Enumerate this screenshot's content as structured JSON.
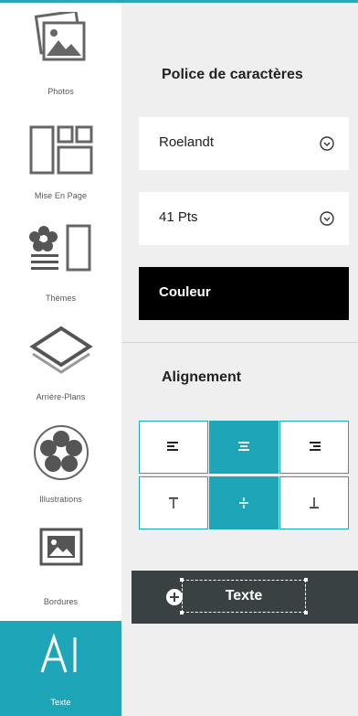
{
  "sidebar": {
    "items": [
      {
        "label": "Photos",
        "icon": "photos-icon"
      },
      {
        "label": "Mise En Page",
        "icon": "layout-icon"
      },
      {
        "label": "Thèmes",
        "icon": "themes-icon"
      },
      {
        "label": "Arrière-Plans",
        "icon": "backgrounds-icon"
      },
      {
        "label": "Illustrations",
        "icon": "flower-icon"
      },
      {
        "label": "Bordures",
        "icon": "frame-icon"
      },
      {
        "label": "Texte",
        "icon": "text-cursor-icon",
        "active": true
      }
    ]
  },
  "panel": {
    "font_title": "Police de caractères",
    "font_family": "Roelandt",
    "font_size": "41 Pts",
    "color_button": "Couleur",
    "alignment_title": "Alignement",
    "add_text_button": "Texte"
  },
  "colors": {
    "accent": "#1ea6b8",
    "dark_button": "#3a4142",
    "black_button": "#000000"
  }
}
